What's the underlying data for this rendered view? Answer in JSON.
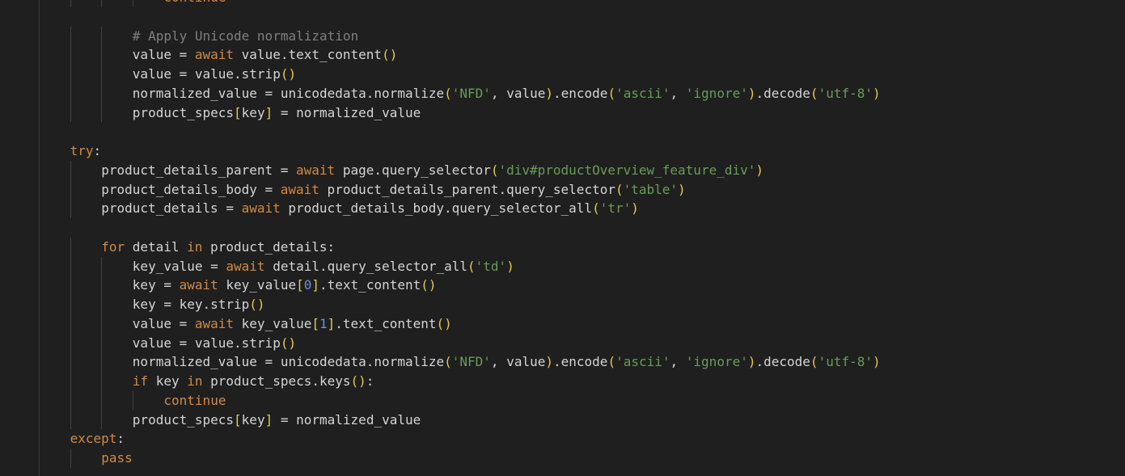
{
  "editor": {
    "lines": [
      {
        "indent": 4,
        "tokens": [
          {
            "t": "continue",
            "c": "kw"
          }
        ]
      },
      {
        "indent": 0,
        "tokens": []
      },
      {
        "indent": 3,
        "tokens": [
          {
            "t": "# Apply Unicode normalization",
            "c": "cmt"
          }
        ]
      },
      {
        "indent": 3,
        "tokens": [
          {
            "t": "value = ",
            "c": "def"
          },
          {
            "t": "await",
            "c": "kw"
          },
          {
            "t": " value.text_content",
            "c": "def"
          },
          {
            "t": "()",
            "c": "paren"
          }
        ]
      },
      {
        "indent": 3,
        "tokens": [
          {
            "t": "value = value.strip",
            "c": "def"
          },
          {
            "t": "()",
            "c": "paren"
          }
        ]
      },
      {
        "indent": 3,
        "tokens": [
          {
            "t": "normalized_value = unicodedata.normalize",
            "c": "def"
          },
          {
            "t": "(",
            "c": "paren"
          },
          {
            "t": "'NFD'",
            "c": "str"
          },
          {
            "t": ", value",
            "c": "def"
          },
          {
            "t": ")",
            "c": "paren"
          },
          {
            "t": ".encode",
            "c": "def"
          },
          {
            "t": "(",
            "c": "paren"
          },
          {
            "t": "'ascii'",
            "c": "str"
          },
          {
            "t": ", ",
            "c": "def"
          },
          {
            "t": "'ignore'",
            "c": "str"
          },
          {
            "t": ")",
            "c": "paren"
          },
          {
            "t": ".decode",
            "c": "def"
          },
          {
            "t": "(",
            "c": "paren"
          },
          {
            "t": "'utf-8'",
            "c": "str"
          },
          {
            "t": ")",
            "c": "paren"
          }
        ]
      },
      {
        "indent": 3,
        "tokens": [
          {
            "t": "product_specs",
            "c": "def"
          },
          {
            "t": "[",
            "c": "paren"
          },
          {
            "t": "key",
            "c": "def"
          },
          {
            "t": "]",
            "c": "paren"
          },
          {
            "t": " = normalized_value",
            "c": "def"
          }
        ]
      },
      {
        "indent": 0,
        "tokens": []
      },
      {
        "indent": 1,
        "tokens": [
          {
            "t": "try",
            "c": "kw"
          },
          {
            "t": ":",
            "c": "def"
          }
        ]
      },
      {
        "indent": 2,
        "tokens": [
          {
            "t": "product_details_parent = ",
            "c": "def"
          },
          {
            "t": "await",
            "c": "kw"
          },
          {
            "t": " page.query_selector",
            "c": "def"
          },
          {
            "t": "(",
            "c": "paren"
          },
          {
            "t": "'div#productOverview_feature_div'",
            "c": "str"
          },
          {
            "t": ")",
            "c": "paren"
          }
        ]
      },
      {
        "indent": 2,
        "tokens": [
          {
            "t": "product_details_body = ",
            "c": "def"
          },
          {
            "t": "await",
            "c": "kw"
          },
          {
            "t": " product_details_parent.query_selector",
            "c": "def"
          },
          {
            "t": "(",
            "c": "paren"
          },
          {
            "t": "'table'",
            "c": "str"
          },
          {
            "t": ")",
            "c": "paren"
          }
        ]
      },
      {
        "indent": 2,
        "tokens": [
          {
            "t": "product_details = ",
            "c": "def"
          },
          {
            "t": "await",
            "c": "kw"
          },
          {
            "t": " product_details_body.query_selector_all",
            "c": "def"
          },
          {
            "t": "(",
            "c": "paren"
          },
          {
            "t": "'tr'",
            "c": "str"
          },
          {
            "t": ")",
            "c": "paren"
          }
        ]
      },
      {
        "indent": 0,
        "tokens": []
      },
      {
        "indent": 2,
        "tokens": [
          {
            "t": "for",
            "c": "kw"
          },
          {
            "t": " detail ",
            "c": "def"
          },
          {
            "t": "in",
            "c": "kw"
          },
          {
            "t": " product_details:",
            "c": "def"
          }
        ]
      },
      {
        "indent": 3,
        "tokens": [
          {
            "t": "key_value = ",
            "c": "def"
          },
          {
            "t": "await",
            "c": "kw"
          },
          {
            "t": " detail.query_selector_all",
            "c": "def"
          },
          {
            "t": "(",
            "c": "paren"
          },
          {
            "t": "'td'",
            "c": "str"
          },
          {
            "t": ")",
            "c": "paren"
          }
        ]
      },
      {
        "indent": 3,
        "tokens": [
          {
            "t": "key = ",
            "c": "def"
          },
          {
            "t": "await",
            "c": "kw"
          },
          {
            "t": " key_value",
            "c": "def"
          },
          {
            "t": "[",
            "c": "paren"
          },
          {
            "t": "0",
            "c": "num"
          },
          {
            "t": "]",
            "c": "paren"
          },
          {
            "t": ".text_content",
            "c": "def"
          },
          {
            "t": "()",
            "c": "paren"
          }
        ]
      },
      {
        "indent": 3,
        "tokens": [
          {
            "t": "key = key.strip",
            "c": "def"
          },
          {
            "t": "()",
            "c": "paren"
          }
        ]
      },
      {
        "indent": 3,
        "tokens": [
          {
            "t": "value = ",
            "c": "def"
          },
          {
            "t": "await",
            "c": "kw"
          },
          {
            "t": " key_value",
            "c": "def"
          },
          {
            "t": "[",
            "c": "paren"
          },
          {
            "t": "1",
            "c": "num"
          },
          {
            "t": "]",
            "c": "paren"
          },
          {
            "t": ".text_content",
            "c": "def"
          },
          {
            "t": "()",
            "c": "paren"
          }
        ]
      },
      {
        "indent": 3,
        "tokens": [
          {
            "t": "value = value.strip",
            "c": "def"
          },
          {
            "t": "()",
            "c": "paren"
          }
        ]
      },
      {
        "indent": 3,
        "tokens": [
          {
            "t": "normalized_value = unicodedata.normalize",
            "c": "def"
          },
          {
            "t": "(",
            "c": "paren"
          },
          {
            "t": "'NFD'",
            "c": "str"
          },
          {
            "t": ", value",
            "c": "def"
          },
          {
            "t": ")",
            "c": "paren"
          },
          {
            "t": ".encode",
            "c": "def"
          },
          {
            "t": "(",
            "c": "paren"
          },
          {
            "t": "'ascii'",
            "c": "str"
          },
          {
            "t": ", ",
            "c": "def"
          },
          {
            "t": "'ignore'",
            "c": "str"
          },
          {
            "t": ")",
            "c": "paren"
          },
          {
            "t": ".decode",
            "c": "def"
          },
          {
            "t": "(",
            "c": "paren"
          },
          {
            "t": "'utf-8'",
            "c": "str"
          },
          {
            "t": ")",
            "c": "paren"
          }
        ]
      },
      {
        "indent": 3,
        "tokens": [
          {
            "t": "if",
            "c": "kw"
          },
          {
            "t": " key ",
            "c": "def"
          },
          {
            "t": "in",
            "c": "kw"
          },
          {
            "t": " product_specs.keys",
            "c": "def"
          },
          {
            "t": "()",
            "c": "paren"
          },
          {
            "t": ":",
            "c": "def"
          }
        ]
      },
      {
        "indent": 4,
        "tokens": [
          {
            "t": "continue",
            "c": "kw"
          }
        ]
      },
      {
        "indent": 3,
        "tokens": [
          {
            "t": "product_specs",
            "c": "def"
          },
          {
            "t": "[",
            "c": "paren"
          },
          {
            "t": "key",
            "c": "def"
          },
          {
            "t": "]",
            "c": "paren"
          },
          {
            "t": " = normalized_value",
            "c": "def"
          }
        ]
      },
      {
        "indent": 1,
        "tokens": [
          {
            "t": "except",
            "c": "kw"
          },
          {
            "t": ":",
            "c": "def"
          }
        ]
      },
      {
        "indent": 2,
        "tokens": [
          {
            "t": "pass",
            "c": "kw"
          }
        ]
      }
    ],
    "colors": {
      "background": "#1f1f1f",
      "keyword": "#d08a45",
      "string": "#6a9a5a",
      "comment": "#7f7f7f",
      "number": "#6b8fd6",
      "bracket": "#e6c84d",
      "default": "#d4d4d4"
    }
  }
}
